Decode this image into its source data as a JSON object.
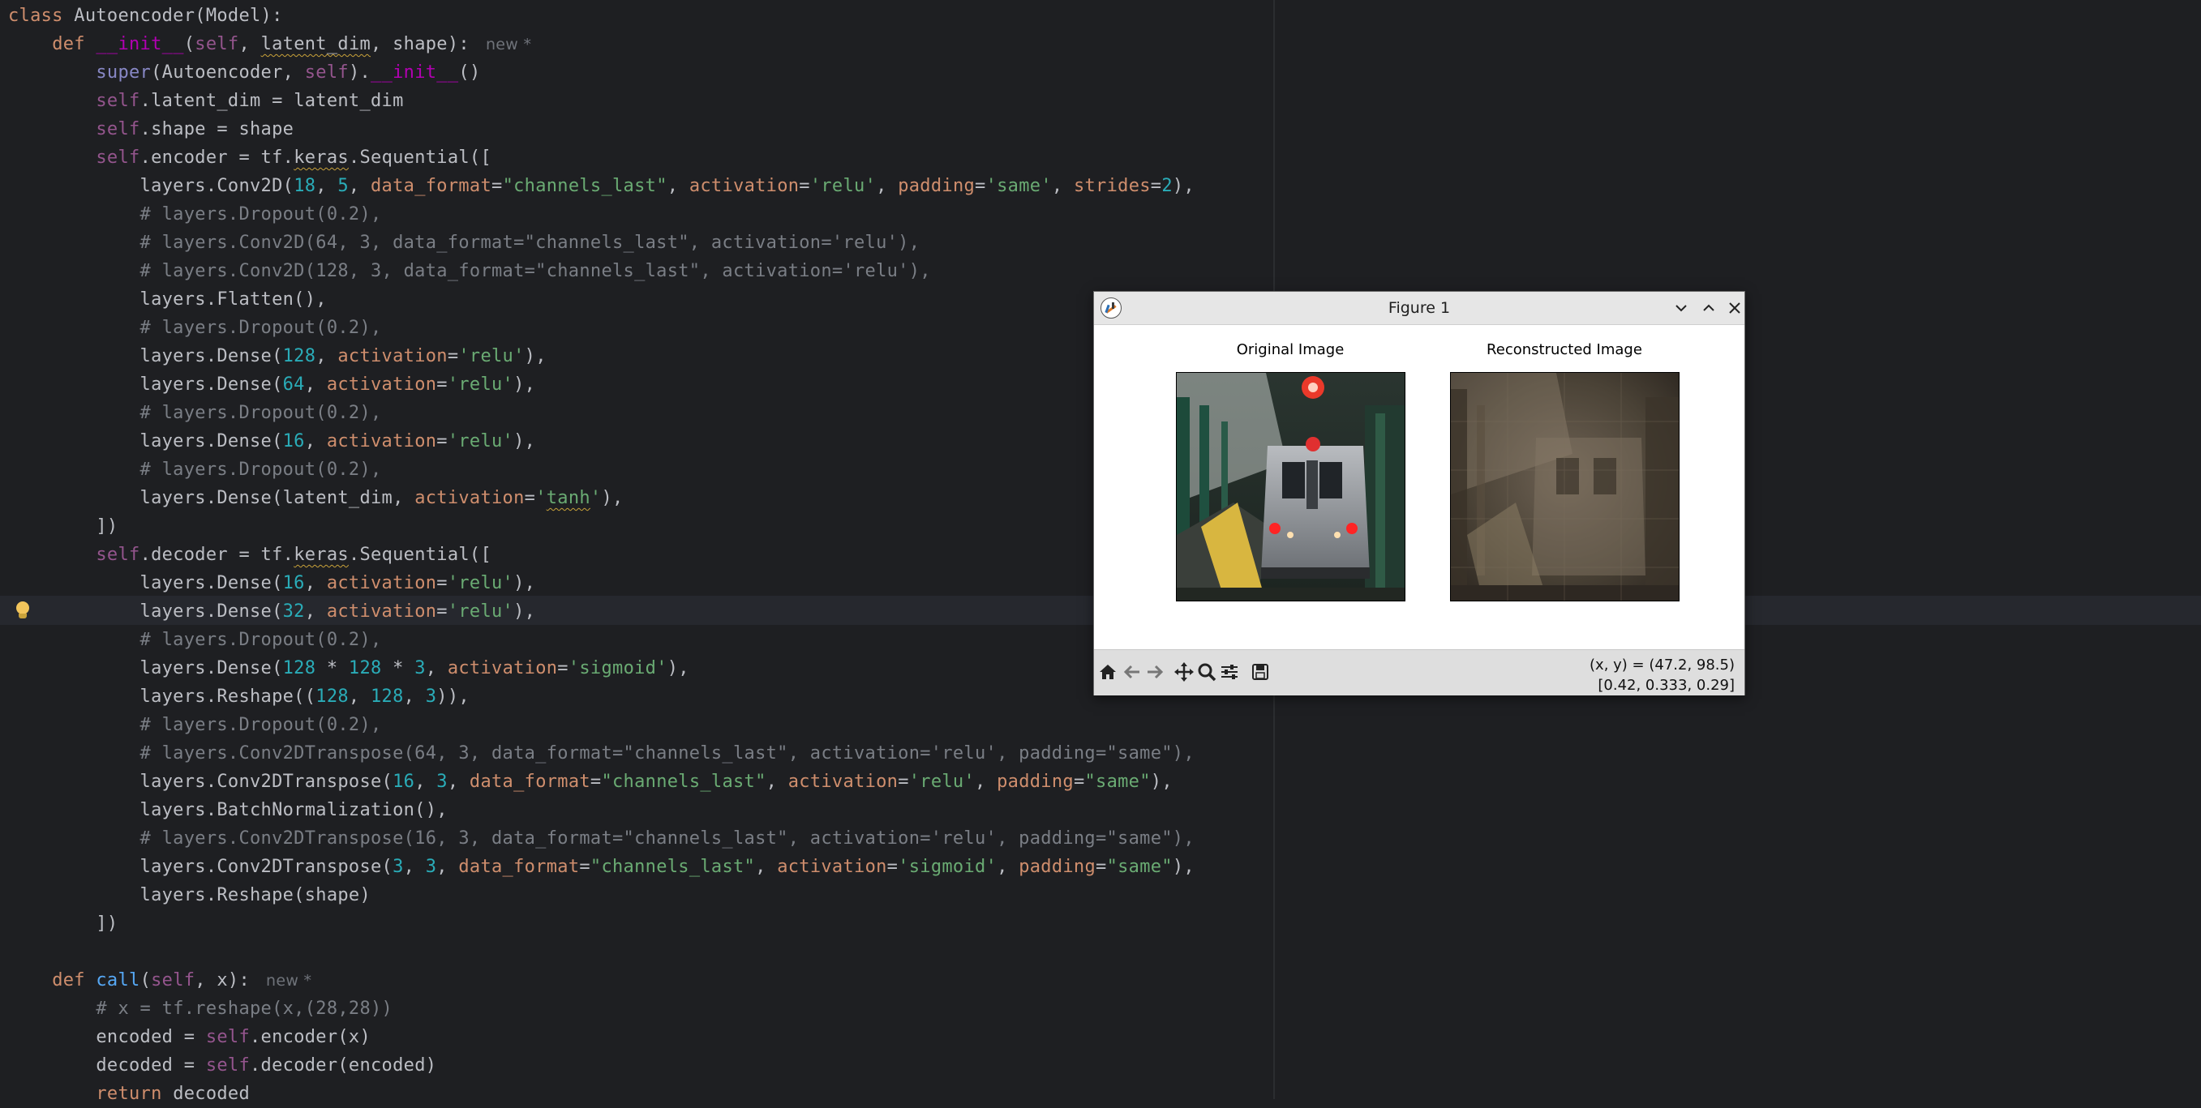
{
  "editor": {
    "hint": "new *",
    "lines": {
      "l1_class": "class",
      "l1_name": "Autoencoder",
      "l1_rest": "(Model):",
      "l2_def": "def",
      "l2_init": "__init__",
      "l2_self": "self",
      "l2_latent": "latent_dim",
      "l2_rest": ", shape):",
      "l3_super": "super",
      "l3_mid": "(Autoencoder, ",
      "l3_self": "self",
      "l3_dot": ").",
      "l3_init": "__init__",
      "l3_end": "()",
      "l4_self": "self",
      "l4_rest": ".latent_dim = latent_dim",
      "l5_self": "self",
      "l5_rest": ".shape = shape",
      "l6_self": "self",
      "l6_a": ".encoder = tf.",
      "l6_keras": "keras",
      "l6_b": ".Sequential([",
      "l7": "layers.Conv2D(",
      "l7_n1": "18",
      "l7_n2": "5",
      "l7_p1": "data_format",
      "l7_s1": "\"channels_last\"",
      "l7_p2": "activation",
      "l7_s2": "'relu'",
      "l7_p3": "padding",
      "l7_s3": "'same'",
      "l7_p4": "strides",
      "l7_n3": "2",
      "l8": "# layers.Dropout(0.2),",
      "l9": "# layers.Conv2D(64, 3, data_format=\"channels_last\", activation='relu'),",
      "l10": "# layers.Conv2D(128, 3, data_format=\"channels_last\", activation='relu'),",
      "l11": "layers.Flatten(),",
      "l12": "# layers.Dropout(0.2),",
      "l13_a": "layers.Dense(",
      "l13_n": "128",
      "l13_p": "activation",
      "l13_s": "'relu'",
      "l14_a": "layers.Dense(",
      "l14_n": "64",
      "l14_p": "activation",
      "l14_s": "'relu'",
      "l15": "# layers.Dropout(0.2),",
      "l16_a": "layers.Dense(",
      "l16_n": "16",
      "l16_p": "activation",
      "l16_s": "'relu'",
      "l17": "# layers.Dropout(0.2),",
      "l18_a": "layers.Dense(latent_dim, ",
      "l18_p": "activation",
      "l18_s1": "'",
      "l18_tanh": "tanh",
      "l18_s2": "'",
      "l19": "])",
      "l20_self": "self",
      "l20_a": ".decoder = tf.",
      "l20_keras": "keras",
      "l20_b": ".Sequential([",
      "l21_a": "layers.Dense(",
      "l21_n": "16",
      "l21_p": "activation",
      "l21_s": "'relu'",
      "l22_a": "layers.Dense(",
      "l22_n": "32",
      "l22_p": "activation",
      "l22_s": "'relu'",
      "l23": "# layers.Dropout(0.2),",
      "l24_a": "layers.Dense(",
      "l24_n1": "128",
      "l24_n2": "128",
      "l24_n3": "3",
      "l24_p": "activation",
      "l24_s": "'sigmoid'",
      "l25_a": "layers.Reshape((",
      "l25_n1": "128",
      "l25_n2": "128",
      "l25_n3": "3",
      "l26": "# layers.Dropout(0.2),",
      "l27": "# layers.Conv2DTranspose(64, 3, data_format=\"channels_last\", activation='relu', padding=\"same\"),",
      "l28_a": "layers.Conv2DTranspose(",
      "l28_n1": "16",
      "l28_n2": "3",
      "l28_p1": "data_format",
      "l28_s1": "\"channels_last\"",
      "l28_p2": "activation",
      "l28_s2": "'relu'",
      "l28_p3": "padding",
      "l28_s3": "\"same\"",
      "l29": "layers.BatchNormalization(),",
      "l30": "# layers.Conv2DTranspose(16, 3, data_format=\"channels_last\", activation='relu', padding=\"same\"),",
      "l31_a": "layers.Conv2DTranspose(",
      "l31_n1": "3",
      "l31_n2": "3",
      "l31_p1": "data_format",
      "l31_s1": "\"channels_last\"",
      "l31_p2": "activation",
      "l31_s2": "'sigmoid'",
      "l31_p3": "padding",
      "l31_s3": "\"same\"",
      "l32": "layers.Reshape(shape)",
      "l33": "])",
      "l35_def": "def",
      "l35_call": "call",
      "l35_self": "self",
      "l35_rest": ", x):",
      "l36": "# x = tf.reshape(x,(28,28))",
      "l37_a": "encoded = ",
      "l37_self": "self",
      "l37_b": ".encoder(x)",
      "l38_a": "decoded = ",
      "l38_self": "self",
      "l38_b": ".decoder(encoded)",
      "l39_ret": "return",
      "l39_rest": " decoded"
    }
  },
  "figure": {
    "title": "Figure 1",
    "subplot_titles": [
      "Original Image",
      "Reconstructed Image"
    ],
    "coords_line1": "(x, y) = (47.2, 98.5)",
    "coords_line2": "[0.42, 0.333, 0.29]",
    "toolbar_icons": [
      "home-icon",
      "back-arrow-icon",
      "forward-arrow-icon",
      "pan-icon",
      "zoom-icon",
      "configure-icon",
      "save-icon"
    ],
    "window_buttons": [
      "minimize-icon",
      "maximize-icon",
      "close-icon"
    ]
  }
}
